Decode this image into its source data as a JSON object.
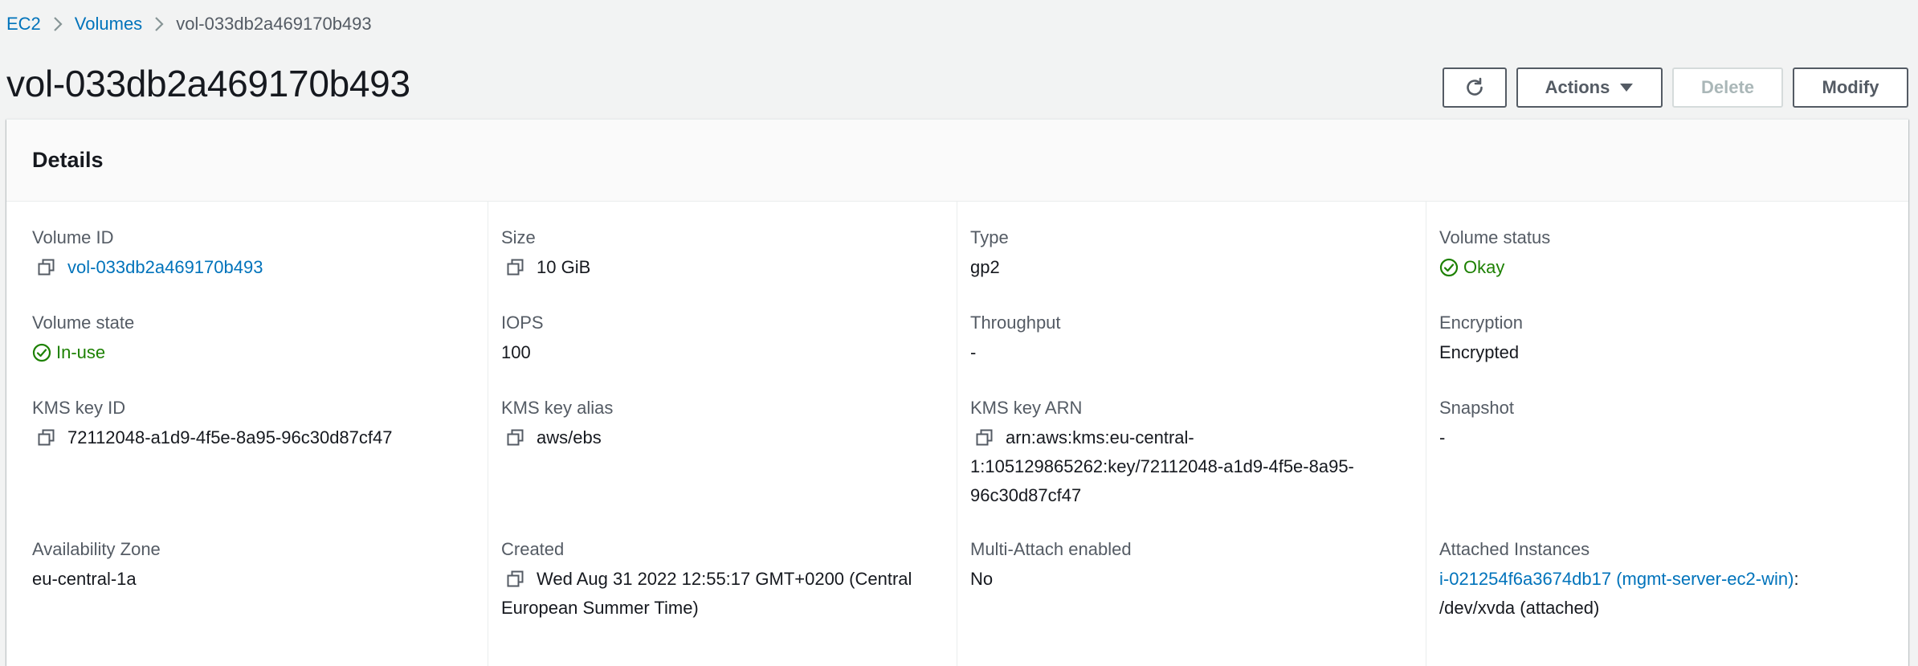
{
  "breadcrumb": {
    "items": [
      "EC2",
      "Volumes"
    ],
    "current": "vol-033db2a469170b493"
  },
  "page": {
    "title": "vol-033db2a469170b493"
  },
  "toolbar": {
    "actions_label": "Actions",
    "delete_label": "Delete",
    "modify_label": "Modify"
  },
  "details": {
    "title": "Details",
    "volume_id": {
      "label": "Volume ID",
      "value": "vol-033db2a469170b493"
    },
    "size": {
      "label": "Size",
      "value": "10 GiB"
    },
    "type": {
      "label": "Type",
      "value": "gp2"
    },
    "volume_status": {
      "label": "Volume status",
      "value": "Okay"
    },
    "volume_state": {
      "label": "Volume state",
      "value": "In-use"
    },
    "iops": {
      "label": "IOPS",
      "value": "100"
    },
    "throughput": {
      "label": "Throughput",
      "value": "-"
    },
    "encryption": {
      "label": "Encryption",
      "value": "Encrypted"
    },
    "kms_key_id": {
      "label": "KMS key ID",
      "value": "72112048-a1d9-4f5e-8a95-96c30d87cf47"
    },
    "kms_key_alias": {
      "label": "KMS key alias",
      "value": "aws/ebs"
    },
    "kms_key_arn": {
      "label": "KMS key ARN",
      "line1": "arn:aws:kms:eu-central-",
      "line2": "1:105129865262:key/72112048-a1d9-4f5e-8a95-",
      "line3": "96c30d87cf47"
    },
    "snapshot": {
      "label": "Snapshot",
      "value": "-"
    },
    "availability_zone": {
      "label": "Availability Zone",
      "value": "eu-central-1a"
    },
    "created": {
      "label": "Created",
      "line1": "Wed Aug 31 2022 12:55:17 GMT+0200 (Central",
      "line2": "European Summer Time)"
    },
    "multi_attach": {
      "label": "Multi-Attach enabled",
      "value": "No"
    },
    "attached_instances": {
      "label": "Attached Instances",
      "instance_link": "i-021254f6a3674db17 (mgmt-server-ec2-win)",
      "suffix": ":",
      "device": "/dev/xvda (attached)"
    }
  },
  "colors": {
    "link": "#0073bb",
    "success": "#1d8102",
    "background": "#f2f3f3"
  },
  "icons": [
    "chevron-right-icon",
    "refresh-icon",
    "caret-down-icon",
    "copy-icon",
    "status-success-icon"
  ]
}
